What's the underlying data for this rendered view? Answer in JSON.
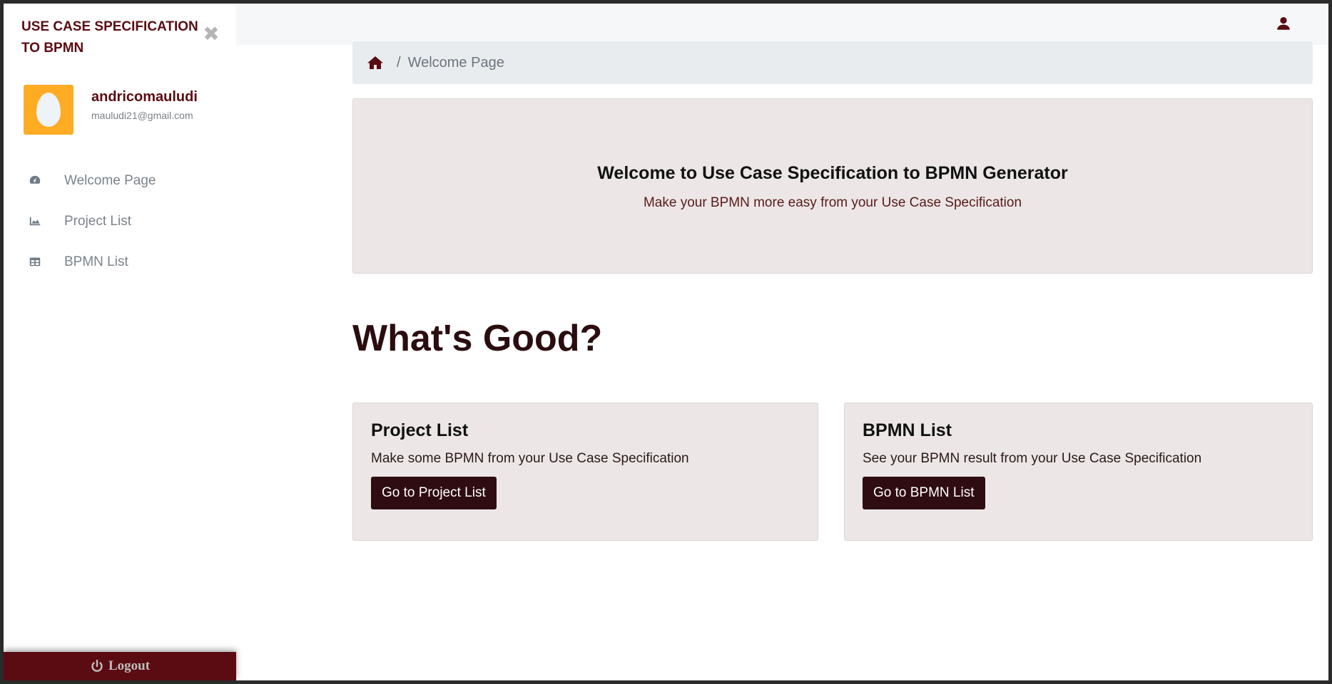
{
  "app": {
    "title": "USE CASE SPECIFICATION TO BPMN",
    "close_icon": "close-icon"
  },
  "user": {
    "name": "andricomauludi",
    "email": "mauludi21@gmail.com"
  },
  "sidebar": {
    "items": [
      {
        "label": "Welcome Page",
        "icon": "dashboard-icon"
      },
      {
        "label": "Project List",
        "icon": "area-chart-icon"
      },
      {
        "label": "BPMN List",
        "icon": "table-icon"
      }
    ],
    "logout_label": "Logout"
  },
  "breadcrumb": {
    "current": "Welcome Page",
    "separator": "/"
  },
  "hero": {
    "title": "Welcome to Use Case Specification to BPMN Generator",
    "subtitle": "Make your BPMN more easy from your Use Case Specification"
  },
  "main": {
    "heading": "What's Good?"
  },
  "cards": [
    {
      "title": "Project List",
      "text": "Make some BPMN from your Use Case Specification",
      "button": "Go to Project List"
    },
    {
      "title": "BPMN List",
      "text": "See your BPMN result from your Use Case Specification",
      "button": "Go to BPMN List"
    }
  ],
  "colors": {
    "brand": "#5a0c12",
    "button": "#2e0c12",
    "card_bg": "#ece7e6",
    "avatar_bg": "#ffab24"
  }
}
